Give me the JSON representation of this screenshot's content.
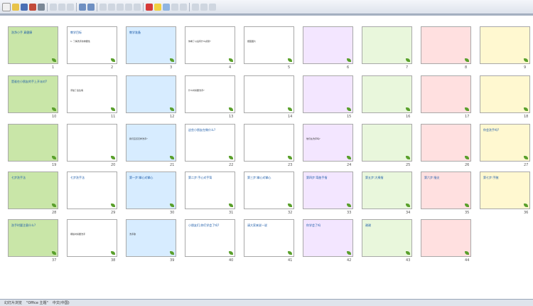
{
  "status": {
    "slide": "幻灯片浏览",
    "theme": "\"Office 主题\"",
    "language": "中文(中国)"
  },
  "slides": [
    {
      "n": "1",
      "title": "洗净小手 真健康",
      "sub": ""
    },
    {
      "n": "2",
      "title": "教学目标",
      "sub": "1. 了解洗手的重要性"
    },
    {
      "n": "3",
      "title": "教学准备",
      "sub": ""
    },
    {
      "n": "4",
      "title": "",
      "sub": "你看了以后有什么感受?"
    },
    {
      "n": "5",
      "title": "",
      "sub": "细菌图片"
    },
    {
      "n": "6",
      "title": "",
      "sub": ""
    },
    {
      "n": "7",
      "title": "",
      "sub": ""
    },
    {
      "n": "8",
      "title": "",
      "sub": ""
    },
    {
      "n": "9",
      "title": "",
      "sub": ""
    },
    {
      "n": "10",
      "title": "是谁在小朋友的手上开派对?",
      "sub": ""
    },
    {
      "n": "11",
      "title": "",
      "sub": "手脏了会生病"
    },
    {
      "n": "12",
      "title": "",
      "sub": ""
    },
    {
      "n": "13",
      "title": "",
      "sub": "什么时候要洗手?"
    },
    {
      "n": "14",
      "title": "",
      "sub": ""
    },
    {
      "n": "15",
      "title": "",
      "sub": ""
    },
    {
      "n": "16",
      "title": "",
      "sub": ""
    },
    {
      "n": "17",
      "title": "",
      "sub": ""
    },
    {
      "n": "18",
      "title": "",
      "sub": ""
    },
    {
      "n": "19",
      "title": "",
      "sub": ""
    },
    {
      "n": "20",
      "title": "",
      "sub": ""
    },
    {
      "n": "21",
      "title": "",
      "sub": "我们应该怎样洗手?"
    },
    {
      "n": "22",
      "title": "这些小朋友在做什么?",
      "sub": ""
    },
    {
      "n": "23",
      "title": "",
      "sub": ""
    },
    {
      "n": "24",
      "title": "",
      "sub": "他们在洗手吗?"
    },
    {
      "n": "25",
      "title": "",
      "sub": ""
    },
    {
      "n": "26",
      "title": "",
      "sub": ""
    },
    {
      "n": "27",
      "title": "你会洗手吗?",
      "sub": ""
    },
    {
      "n": "28",
      "title": "七步洗手法",
      "sub": ""
    },
    {
      "n": "29",
      "title": "七步洗手法",
      "sub": ""
    },
    {
      "n": "30",
      "title": "第一步:掌心对掌心",
      "sub": ""
    },
    {
      "n": "31",
      "title": "第二步:手心对手背",
      "sub": ""
    },
    {
      "n": "32",
      "title": "第三步:掌心对掌心",
      "sub": ""
    },
    {
      "n": "33",
      "title": "第四步:弯曲手指",
      "sub": ""
    },
    {
      "n": "34",
      "title": "第五步:大拇指",
      "sub": ""
    },
    {
      "n": "35",
      "title": "第六步:指尖",
      "sub": ""
    },
    {
      "n": "36",
      "title": "第七步:手腕",
      "sub": ""
    },
    {
      "n": "37",
      "title": "洗手时要注意什么?",
      "sub": ""
    },
    {
      "n": "38",
      "title": "",
      "sub": "哪些时候要洗手"
    },
    {
      "n": "39",
      "title": "",
      "sub": "洗手歌"
    },
    {
      "n": "40",
      "title": "小朋友们,你们学会了吗?",
      "sub": ""
    },
    {
      "n": "41",
      "title": "请大家来说一说",
      "sub": ""
    },
    {
      "n": "42",
      "title": "你学会了吗",
      "sub": ""
    },
    {
      "n": "43",
      "title": "谢谢",
      "sub": ""
    },
    {
      "n": "44",
      "title": "",
      "sub": ""
    }
  ]
}
